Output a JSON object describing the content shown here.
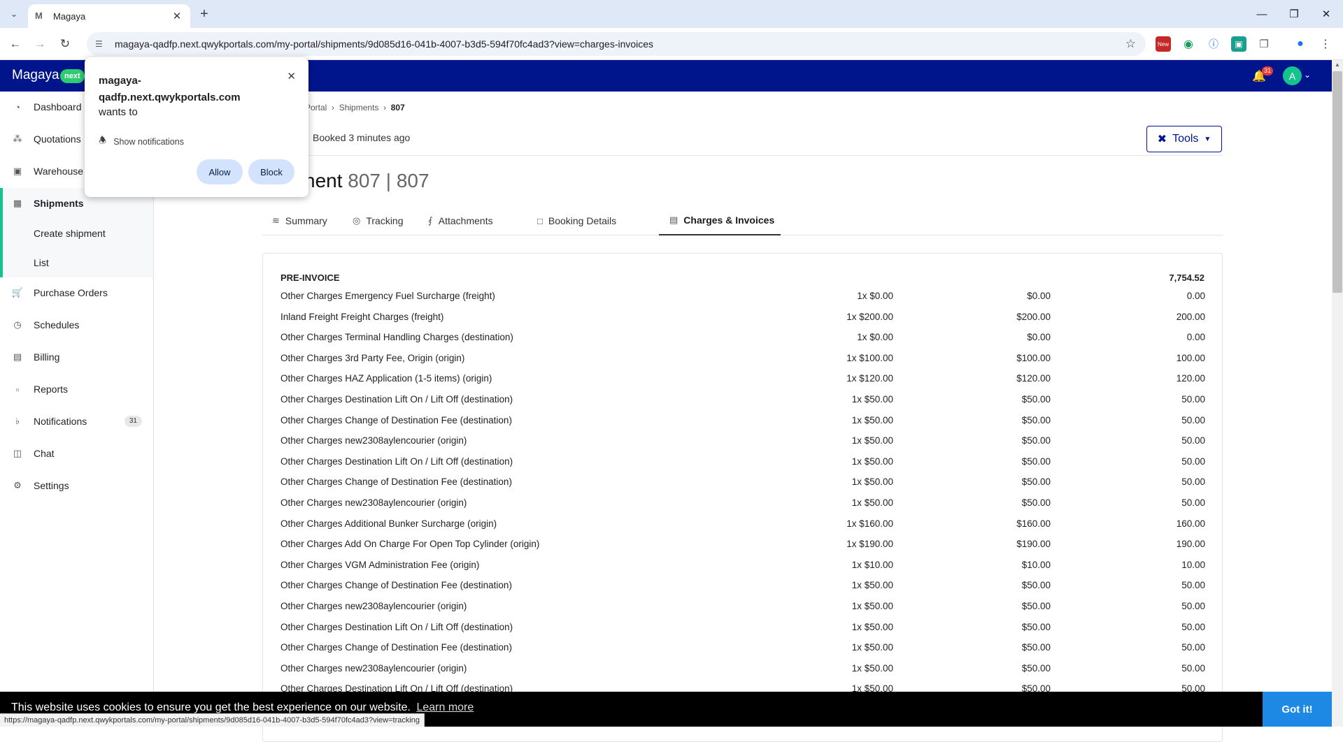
{
  "browser": {
    "tab_title": "Magaya",
    "url": "magaya-qadfp.next.qwykportals.com/my-portal/shipments/9d085d16-041b-4007-b3d5-594f70fc4ad3?view=charges-invoices",
    "status_url": "https://magaya-qadfp.next.qwykportals.com/my-portal/shipments/9d085d16-041b-4007-b3d5-594f70fc4ad3?view=tracking",
    "ext_new_label": "New"
  },
  "header": {
    "brand": "Magaya",
    "brand_badge": "next",
    "notification_count": "31",
    "avatar_initial": "A"
  },
  "sidebar": {
    "items": [
      {
        "label": "Dashboard",
        "icon": "gauge-icon"
      },
      {
        "label": "Quotations",
        "icon": "quotes-icon"
      },
      {
        "label": "Warehouse",
        "icon": "warehouse-icon"
      },
      {
        "label": "Shipments",
        "icon": "box-icon"
      },
      {
        "label": "Purchase Orders",
        "icon": "cart-icon"
      },
      {
        "label": "Schedules",
        "icon": "clock-icon"
      },
      {
        "label": "Billing",
        "icon": "billing-icon"
      },
      {
        "label": "Reports",
        "icon": "chart-icon"
      },
      {
        "label": "Notifications",
        "icon": "bell-icon",
        "badge": "31"
      },
      {
        "label": "Chat",
        "icon": "chat-icon"
      },
      {
        "label": "Settings",
        "icon": "gear-icon"
      }
    ],
    "sub_items": [
      "Create shipment",
      "List"
    ]
  },
  "breadcrumb": {
    "part1": "Portal",
    "part2": "Shipments",
    "current": "807"
  },
  "shipment": {
    "status": "Booked 3 minutes ago",
    "title_prefix": "nent",
    "title_ref": "807 | 807",
    "tools_label": "Tools"
  },
  "tabs": [
    "Summary",
    "Tracking",
    "Attachments",
    "Booking Details",
    "Charges & Invoices"
  ],
  "invoice": {
    "heading": "PRE-INVOICE",
    "total": "7,754.52",
    "rows": [
      {
        "desc": "Other Charges Emergency Fuel Surcharge (freight)",
        "qty": "1x $0.00",
        "unit": "$0.00",
        "amount": "0.00"
      },
      {
        "desc": "Inland Freight Freight Charges (freight)",
        "qty": "1x $200.00",
        "unit": "$200.00",
        "amount": "200.00"
      },
      {
        "desc": "Other Charges Terminal Handling Charges (destination)",
        "qty": "1x $0.00",
        "unit": "$0.00",
        "amount": "0.00"
      },
      {
        "desc": "Other Charges 3rd Party Fee, Origin (origin)",
        "qty": "1x $100.00",
        "unit": "$100.00",
        "amount": "100.00"
      },
      {
        "desc": "Other Charges HAZ Application (1-5 items) (origin)",
        "qty": "1x $120.00",
        "unit": "$120.00",
        "amount": "120.00"
      },
      {
        "desc": "Other Charges Destination Lift On / Lift Off (destination)",
        "qty": "1x $50.00",
        "unit": "$50.00",
        "amount": "50.00"
      },
      {
        "desc": "Other Charges Change of Destination Fee (destination)",
        "qty": "1x $50.00",
        "unit": "$50.00",
        "amount": "50.00"
      },
      {
        "desc": "Other Charges new2308aylencourier (origin)",
        "qty": "1x $50.00",
        "unit": "$50.00",
        "amount": "50.00"
      },
      {
        "desc": "Other Charges Destination Lift On / Lift Off (destination)",
        "qty": "1x $50.00",
        "unit": "$50.00",
        "amount": "50.00"
      },
      {
        "desc": "Other Charges Change of Destination Fee (destination)",
        "qty": "1x $50.00",
        "unit": "$50.00",
        "amount": "50.00"
      },
      {
        "desc": "Other Charges new2308aylencourier (origin)",
        "qty": "1x $50.00",
        "unit": "$50.00",
        "amount": "50.00"
      },
      {
        "desc": "Other Charges Additional Bunker Surcharge (origin)",
        "qty": "1x $160.00",
        "unit": "$160.00",
        "amount": "160.00"
      },
      {
        "desc": "Other Charges Add On Charge For Open Top Cylinder (origin)",
        "qty": "1x $190.00",
        "unit": "$190.00",
        "amount": "190.00"
      },
      {
        "desc": "Other Charges VGM Administration Fee (origin)",
        "qty": "1x $10.00",
        "unit": "$10.00",
        "amount": "10.00"
      },
      {
        "desc": "Other Charges Change of Destination Fee (destination)",
        "qty": "1x $50.00",
        "unit": "$50.00",
        "amount": "50.00"
      },
      {
        "desc": "Other Charges new2308aylencourier (origin)",
        "qty": "1x $50.00",
        "unit": "$50.00",
        "amount": "50.00"
      },
      {
        "desc": "Other Charges Destination Lift On / Lift Off (destination)",
        "qty": "1x $50.00",
        "unit": "$50.00",
        "amount": "50.00"
      },
      {
        "desc": "Other Charges Change of Destination Fee (destination)",
        "qty": "1x $50.00",
        "unit": "$50.00",
        "amount": "50.00"
      },
      {
        "desc": "Other Charges new2308aylencourier (origin)",
        "qty": "1x $50.00",
        "unit": "$50.00",
        "amount": "50.00"
      },
      {
        "desc": "Other Charges Destination Lift On / Lift Off (destination)",
        "qty": "1x $50.00",
        "unit": "$50.00",
        "amount": "50.00"
      }
    ]
  },
  "permission_popup": {
    "origin": "magaya-qadfp.next.qwykportals.com",
    "wants": "wants to",
    "permission": "Show notifications",
    "allow_label": "Allow",
    "block_label": "Block"
  },
  "cookie": {
    "text": "This website uses cookies to ensure you get the best experience on our website.",
    "link": "Learn more",
    "button": "Got it!"
  }
}
